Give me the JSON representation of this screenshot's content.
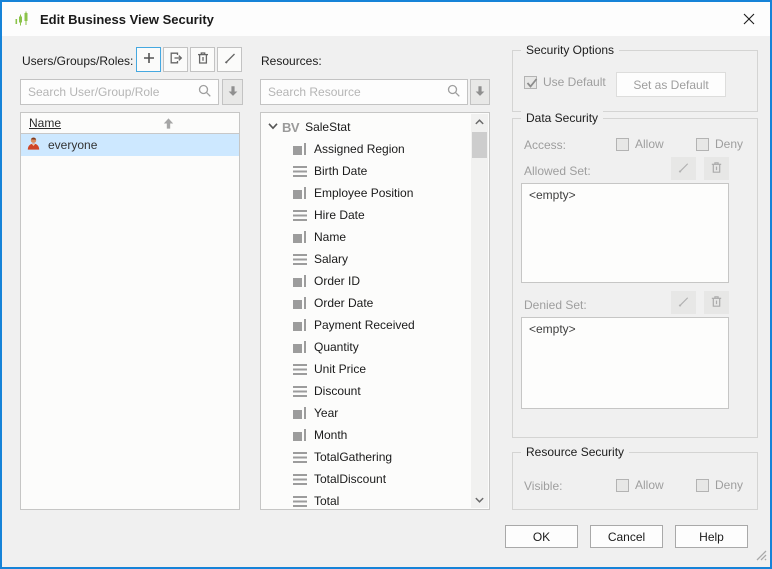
{
  "dialog": {
    "title": "Edit Business View Security"
  },
  "users_panel": {
    "label": "Users/Groups/Roles:",
    "toolbar": {
      "add": "add",
      "move_out": "move-out",
      "delete": "delete",
      "edit": "edit"
    },
    "search_placeholder": "Search User/Group/Role",
    "list": {
      "header": "Name",
      "rows": [
        {
          "label": "everyone"
        }
      ]
    }
  },
  "resources_panel": {
    "label": "Resources:",
    "search_placeholder": "Search Resource",
    "tree": {
      "root": {
        "badge": "BV",
        "label": "SaleStat"
      },
      "items": [
        {
          "label": "Assigned Region",
          "icon": "dimension-icon"
        },
        {
          "label": "Birth Date",
          "icon": "detail-icon"
        },
        {
          "label": "Employee Position",
          "icon": "dimension-icon"
        },
        {
          "label": "Hire Date",
          "icon": "detail-icon"
        },
        {
          "label": "Name",
          "icon": "dimension-icon"
        },
        {
          "label": "Salary",
          "icon": "detail-icon"
        },
        {
          "label": "Order ID",
          "icon": "dimension-icon"
        },
        {
          "label": "Order Date",
          "icon": "dimension-icon"
        },
        {
          "label": "Payment Received",
          "icon": "dimension-icon"
        },
        {
          "label": "Quantity",
          "icon": "dimension-icon"
        },
        {
          "label": "Unit Price",
          "icon": "detail-icon"
        },
        {
          "label": "Discount",
          "icon": "detail-icon"
        },
        {
          "label": "Year",
          "icon": "dimension-icon"
        },
        {
          "label": "Month",
          "icon": "dimension-icon"
        },
        {
          "label": "TotalGathering",
          "icon": "detail-icon"
        },
        {
          "label": "TotalDiscount",
          "icon": "detail-icon"
        },
        {
          "label": "Total",
          "icon": "detail-icon"
        }
      ]
    }
  },
  "security_options": {
    "legend": "Security Options",
    "use_default_label": "Use Default",
    "use_default_checked": true,
    "set_as_default_label": "Set as Default"
  },
  "data_security": {
    "legend": "Data Security",
    "access_label": "Access:",
    "allow_label": "Allow",
    "deny_label": "Deny",
    "allowed_set_label": "Allowed Set:",
    "allowed_set_value": "<empty>",
    "denied_set_label": "Denied Set:",
    "denied_set_value": "<empty>"
  },
  "resource_security": {
    "legend": "Resource Security",
    "visible_label": "Visible:",
    "allow_label": "Allow",
    "deny_label": "Deny"
  },
  "footer": {
    "ok": "OK",
    "cancel": "Cancel",
    "help": "Help"
  },
  "colors": {
    "dialog_border": "#1683d8",
    "titlebar_bg": "#fdfdfd",
    "content_bg": "#f0f0f0",
    "selected_row_bg": "#cde8ff",
    "accent_button_border": "#45a8e0",
    "app_icon_green": "#8bc34a"
  }
}
